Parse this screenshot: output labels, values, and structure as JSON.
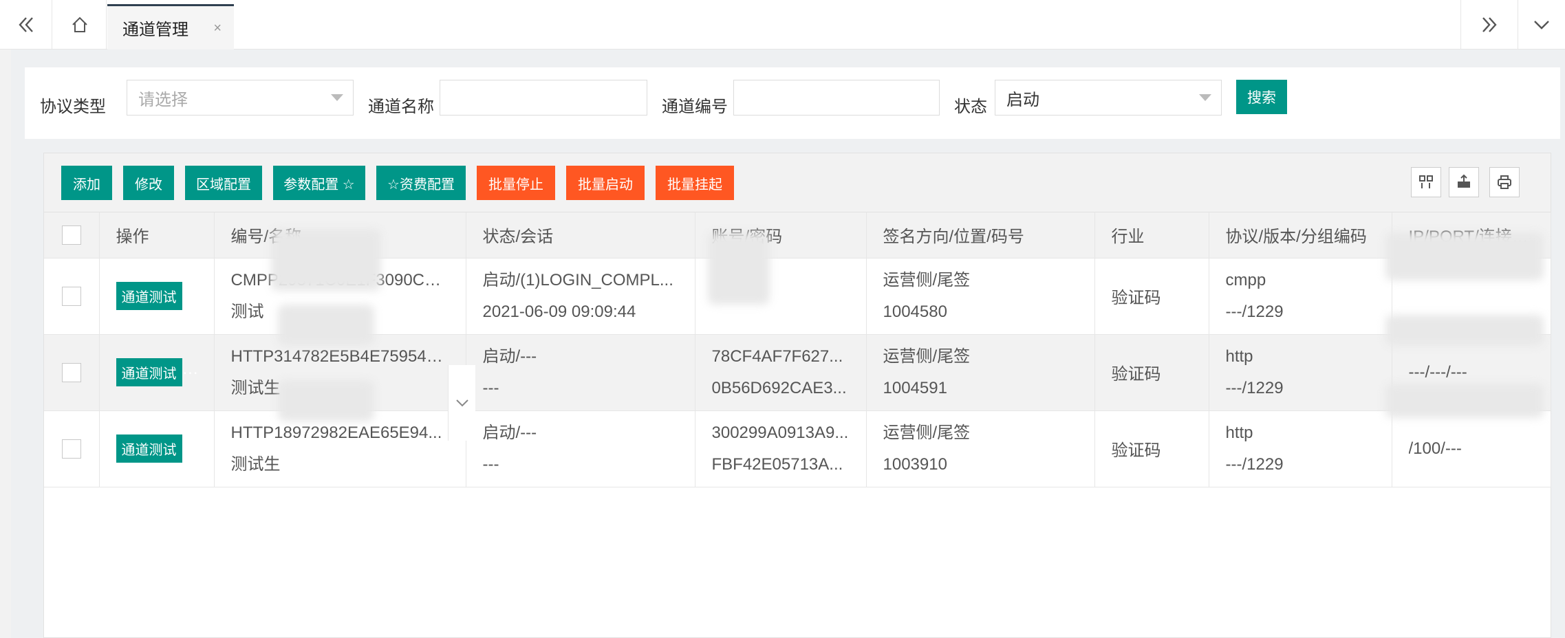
{
  "topbar": {
    "active_tab": "通道管理",
    "close_glyph": "×",
    "icons": [
      "double-chevron-left-icon",
      "home-icon",
      "double-chevron-right-icon",
      "chevron-down-icon"
    ]
  },
  "search": {
    "protocol_label": "协议类型",
    "protocol_placeholder": "请选择",
    "name_label": "通道名称",
    "name_value": "",
    "code_label": "通道编号",
    "code_value": "",
    "status_label": "状态",
    "status_value": "启动",
    "search_button": "搜索"
  },
  "toolbar": {
    "add": "添加",
    "edit": "修改",
    "region": "区域配置",
    "params": "参数配置 ☆",
    "fee": "☆资费配置",
    "batch_stop": "批量停止",
    "batch_start": "批量启动",
    "batch_hang": "批量挂起",
    "icons": [
      "columns-icon",
      "export-icon",
      "print-icon"
    ]
  },
  "columns": [
    "操作",
    "编号/名称",
    "状态/会话",
    "账号/密码",
    "签名方向/位置/码号",
    "行业",
    "协议/版本/分组编码",
    "IP/PORT/连接数/速"
  ],
  "rows": [
    {
      "action": "通道测试",
      "id": "CMPP29371C0E1F3090CA...",
      "name": "测试",
      "status": "启动/(1)LOGIN_COMPL...",
      "session": "2021-06-09 09:09:44",
      "account": "",
      "password": "",
      "sign": "运营侧/尾签",
      "code": "1004580",
      "industry": "验证码",
      "protocol": "cmpp",
      "version": "---/1229",
      "ip": "",
      "port": ""
    },
    {
      "action": "通道测试",
      "id": "HTTP314782E5B4E759543...",
      "name": "测试生",
      "status": "启动/---",
      "session": "---",
      "account": "78CF4AF7F627...",
      "password": "0B56D692CAE3...",
      "sign": "运营侧/尾签",
      "code": "1004591",
      "industry": "验证码",
      "protocol": "http",
      "version": "---/1229",
      "ip": "",
      "port": "---/---/---"
    },
    {
      "action": "通道测试",
      "id": "HTTP18972982EAE65E94...",
      "name": "测试生",
      "status": "启动/---",
      "session": "---",
      "account": "300299A0913A9...",
      "password": "FBF42E05713A...",
      "sign": "运营侧/尾签",
      "code": "1003910",
      "industry": "验证码",
      "protocol": "http",
      "version": "---/1229",
      "ip": "",
      "port": "/100/---"
    }
  ],
  "colors": {
    "primary": "#009688",
    "warn": "#ff5722",
    "dark": "#2f4050"
  }
}
